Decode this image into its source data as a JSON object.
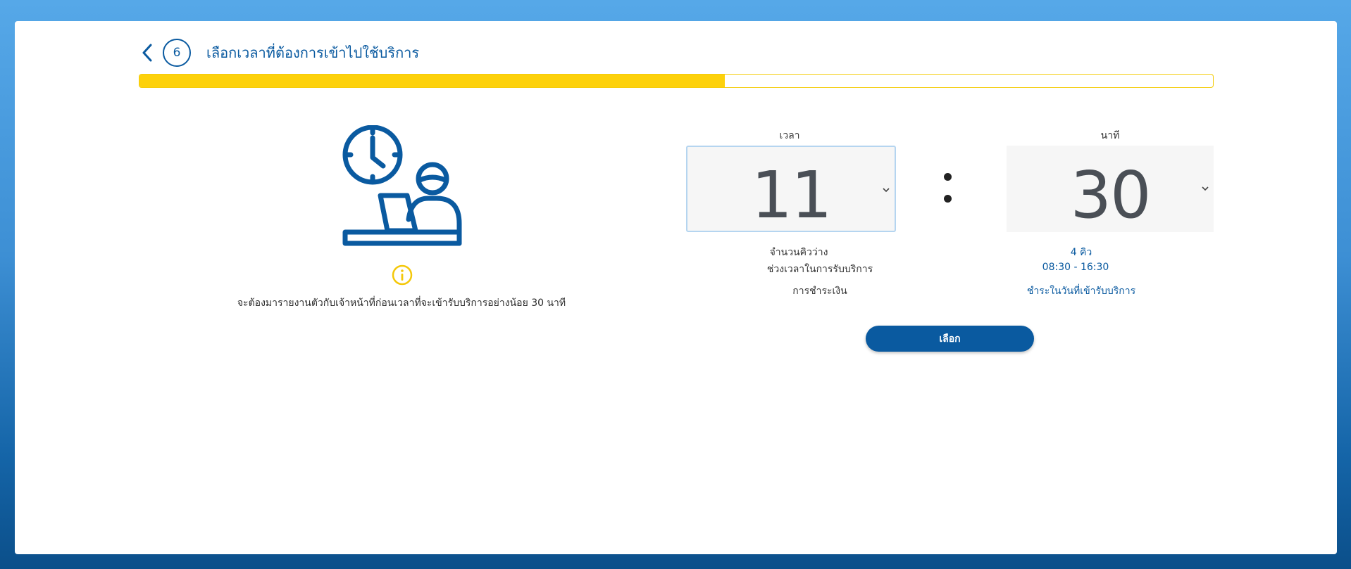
{
  "header": {
    "step_number": "6",
    "title": "เลือกเวลาที่ต้องการเข้าไปใช้บริการ"
  },
  "progress": {
    "fraction": 0.545
  },
  "notice_text": "จะต้องมารายงานตัวกับเจ้าหน้าที่ก่อนเวลาที่จะเข้ารับบริการอย่างน้อย 30 นาที",
  "time_picker": {
    "hour_label": "เวลา",
    "hour_value": "11",
    "minute_label": "นาที",
    "minute_value": "30"
  },
  "details": {
    "queue_label": "จำนวนคิวว่าง",
    "queue_value": "4 คิว",
    "service_time_label": "ช่วงเวลาในการรับบริการ",
    "service_time_value": "08:30 - 16:30",
    "payment_label": "การชำระเงิน",
    "payment_value": "ชำระในวันที่เข้ารับบริการ"
  },
  "select_button_label": "เลือก",
  "colors": {
    "primary": "#0a5aa0",
    "accent": "#fdd10b"
  },
  "icons": [
    "back-arrow-icon",
    "clock-person-laptop-icon",
    "info-icon",
    "chevron-down-icon"
  ]
}
